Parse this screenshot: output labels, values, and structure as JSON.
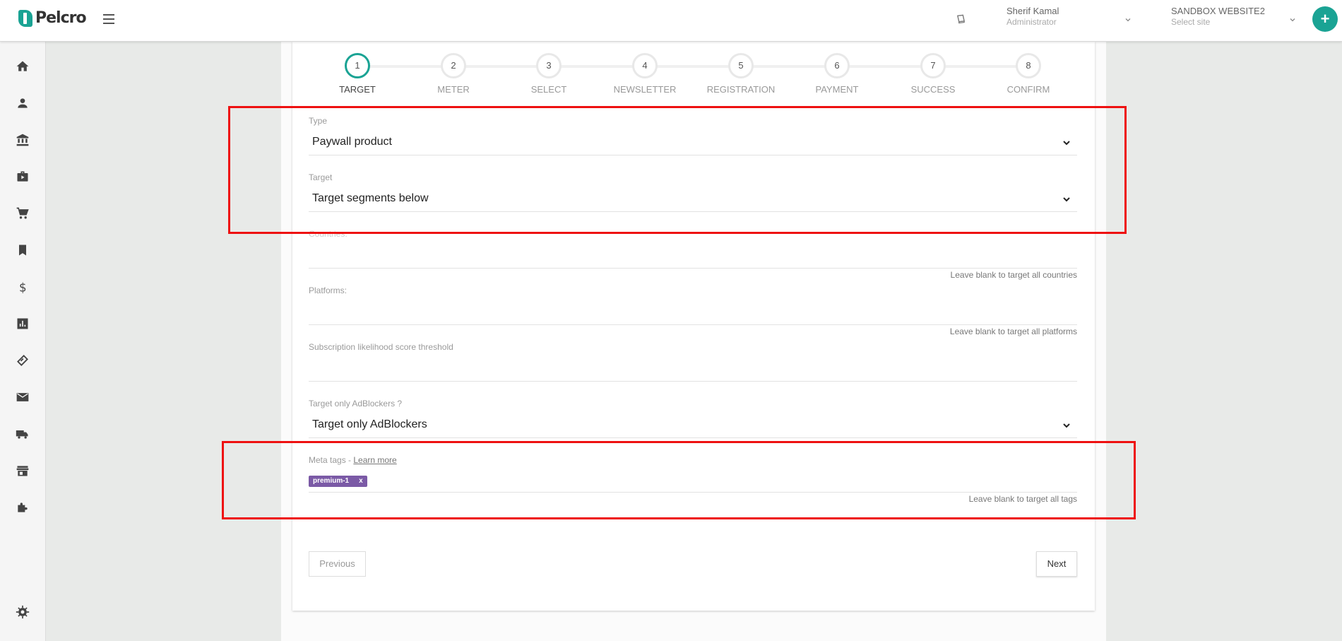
{
  "app": {
    "brand": "Pelcro"
  },
  "header": {
    "user_name": "Sherif Kamal",
    "user_role": "Administrator",
    "site_name": "SANDBOX WEBSITE2",
    "site_placeholder": "Select site",
    "add_label": "+"
  },
  "sidebar": {
    "items": [
      {
        "icon": "home-icon"
      },
      {
        "icon": "person-icon"
      },
      {
        "icon": "bank-icon"
      },
      {
        "icon": "briefcase-icon"
      },
      {
        "icon": "cart-icon"
      },
      {
        "icon": "bookmark-icon"
      },
      {
        "icon": "dollar-icon"
      },
      {
        "icon": "bar-chart-icon"
      },
      {
        "icon": "coupon-icon"
      },
      {
        "icon": "mail-icon"
      },
      {
        "icon": "truck-icon"
      },
      {
        "icon": "store-icon"
      },
      {
        "icon": "puzzle-icon"
      }
    ],
    "settings_icon": "gear-icon"
  },
  "stepper": {
    "steps": [
      {
        "number": "1",
        "label": "TARGET",
        "active": true
      },
      {
        "number": "2",
        "label": "METER"
      },
      {
        "number": "3",
        "label": "SELECT"
      },
      {
        "number": "4",
        "label": "NEWSLETTER"
      },
      {
        "number": "5",
        "label": "REGISTRATION"
      },
      {
        "number": "6",
        "label": "PAYMENT"
      },
      {
        "number": "7",
        "label": "SUCCESS"
      },
      {
        "number": "8",
        "label": "CONFIRM"
      }
    ]
  },
  "form": {
    "type": {
      "label": "Type",
      "value": "Paywall product"
    },
    "target": {
      "label": "Target",
      "value": "Target segments below"
    },
    "countries": {
      "label": "Countries:",
      "help": "Leave blank to target all countries"
    },
    "platforms": {
      "label": "Platforms:",
      "help": "Leave blank to target all platforms"
    },
    "likelihood": {
      "label": "Subscription likelihood score threshold"
    },
    "adblockers": {
      "label": "Target only AdBlockers ?",
      "value": "Target only AdBlockers"
    },
    "meta_tags": {
      "label": "Meta tags - ",
      "link": "Learn more",
      "tags": [
        {
          "name": "premium-1",
          "remove": "x"
        }
      ],
      "help": "Leave blank to target all tags"
    }
  },
  "actions": {
    "previous": "Previous",
    "next": "Next"
  },
  "colors": {
    "accent": "#1aa394",
    "tag": "#7b5aa6",
    "highlight": "#ee1111"
  }
}
